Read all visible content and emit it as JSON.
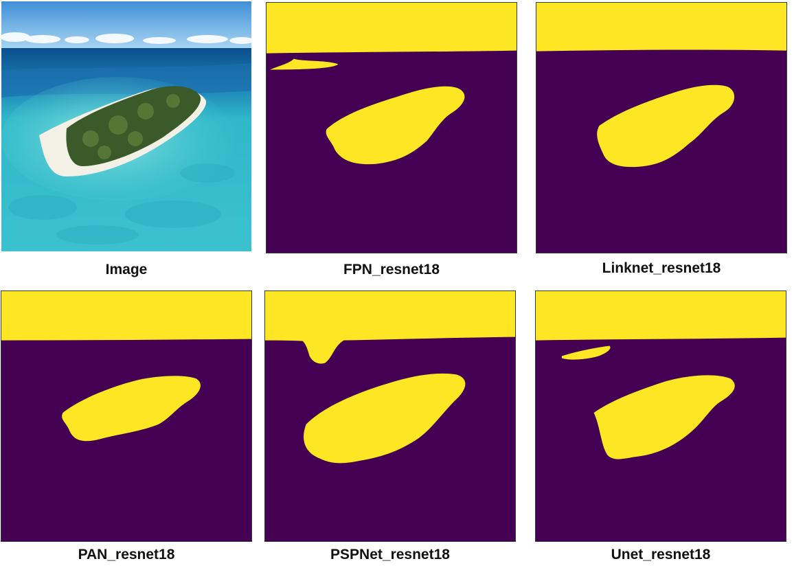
{
  "colors": {
    "mask_background": "#440154",
    "mask_foreground": "#fde725",
    "caption_text": "#111111"
  },
  "panels": [
    {
      "id": "image",
      "label": "Image"
    },
    {
      "id": "fpn",
      "label": "FPN_resnet18"
    },
    {
      "id": "linknet",
      "label": "Linknet_resnet18"
    },
    {
      "id": "pan",
      "label": "PAN_resnet18"
    },
    {
      "id": "pspnet",
      "label": "PSPNet_resnet18"
    },
    {
      "id": "unet",
      "label": "Unet_resnet18"
    }
  ]
}
